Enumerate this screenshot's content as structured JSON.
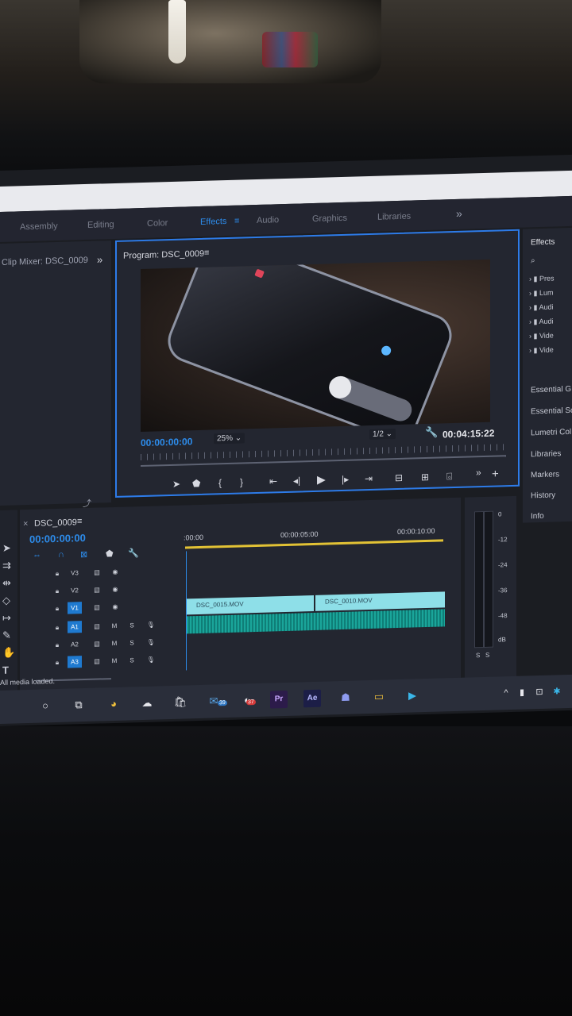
{
  "workspaces": {
    "tabs": [
      {
        "label": "Assembly"
      },
      {
        "label": "Editing"
      },
      {
        "label": "Color"
      },
      {
        "label": "Effects"
      },
      {
        "label": "Audio"
      },
      {
        "label": "Graphics"
      },
      {
        "label": "Libraries"
      }
    ],
    "active": "Effects",
    "more_icon": "double-chevron-right-icon"
  },
  "left_panel": {
    "title": "Clip Mixer: DSC_0009"
  },
  "program_monitor": {
    "title": "Program: DSC_0009",
    "current_timecode": "00:00:00:00",
    "zoom": "25%",
    "resolution": "1/2",
    "duration_timecode": "00:04:15:22"
  },
  "right_panel": {
    "title": "Effects",
    "tree_items": [
      "Pres",
      "Lum",
      "Audi",
      "Audi",
      "Vide",
      "Vide"
    ],
    "sections": [
      "Essential G",
      "Essential So",
      "Lumetri Col",
      "Libraries",
      "Markers",
      "History",
      "Info"
    ]
  },
  "timeline": {
    "sequence_name": "DSC_0009",
    "timecode": "00:00:00:00",
    "ruler_labels": [
      ":00:00",
      "00:00:05:00",
      "00:00:10:00"
    ],
    "tracks": [
      {
        "name": "V3",
        "targeted": false
      },
      {
        "name": "V2",
        "targeted": false
      },
      {
        "name": "V1",
        "targeted": true
      },
      {
        "name": "A1",
        "targeted": true
      },
      {
        "name": "A2",
        "targeted": false
      },
      {
        "name": "A3",
        "targeted": true
      }
    ],
    "track_buttons": {
      "mute": "M",
      "solo": "S"
    },
    "clips": [
      {
        "label": "DSC_0015.MOV"
      },
      {
        "label": "DSC_0010.MOV"
      }
    ]
  },
  "audio_meters": {
    "scale": [
      "0",
      "-12",
      "-24",
      "-36",
      "-48",
      "dB"
    ],
    "solo_labels": [
      "S",
      "S"
    ]
  },
  "status_bar": {
    "text": "All media loaded."
  },
  "taskbar": {
    "badges": {
      "mail": "39",
      "other": "37"
    },
    "pr_label": "Pr",
    "ae_label": "Ae"
  }
}
